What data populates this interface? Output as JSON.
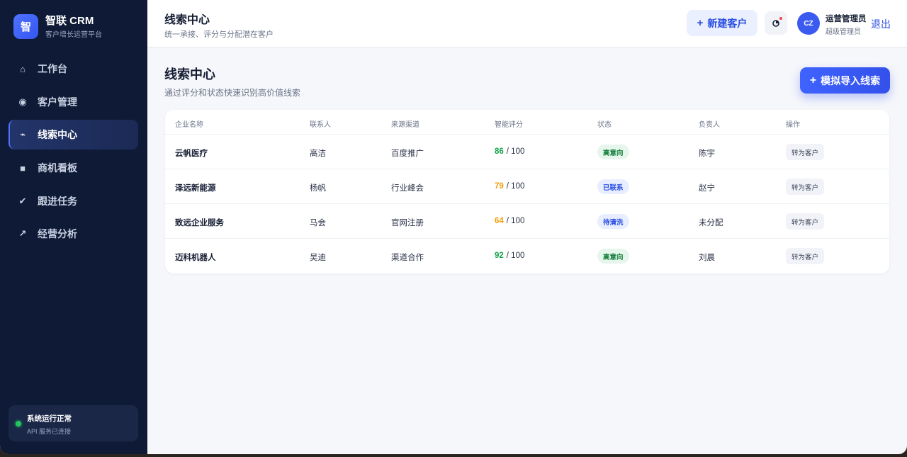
{
  "brand": {
    "logo_char": "智",
    "name": "智联 CRM",
    "subtitle": "客户增长运营平台"
  },
  "sidebar": {
    "items": [
      {
        "icon": "home-icon",
        "glyph": "⌂",
        "label": "工作台",
        "active": false
      },
      {
        "icon": "target-icon",
        "glyph": "◉",
        "label": "客户管理",
        "active": false
      },
      {
        "icon": "lightning-icon",
        "glyph": "⌁",
        "label": "线索中心",
        "active": true
      },
      {
        "icon": "board-icon",
        "glyph": "■",
        "label": "商机看板",
        "active": false
      },
      {
        "icon": "check-icon",
        "glyph": "✔",
        "label": "跟进任务",
        "active": false
      },
      {
        "icon": "trend-icon",
        "glyph": "↗",
        "label": "经营分析",
        "active": false
      }
    ],
    "status": {
      "title": "系统运行正常",
      "subtitle": "API 服务已连接",
      "color": "#22c55e"
    }
  },
  "topbar": {
    "title": "线索中心",
    "subtitle": "统一承接、评分与分配潜在客户",
    "new_button": "新建客户",
    "notification_icon": "timer-icon",
    "user": {
      "initials": "CZ",
      "name": "运营管理员",
      "role": "超级管理员"
    },
    "logout": "退出"
  },
  "page": {
    "title": "线索中心",
    "subtitle": "通过评分和状态快速识别高价值线索",
    "import_button": "模拟导入线索"
  },
  "table": {
    "columns": [
      "企业名称",
      "联系人",
      "来源渠道",
      "智能评分",
      "状态",
      "负责人",
      "操作"
    ],
    "rows": [
      {
        "company": "云帆医疗",
        "contact": "高洁",
        "channel": "百度推广",
        "score": "86",
        "score_max": "/ 100",
        "score_color": "#16a34a",
        "status": "高意向",
        "status_type": "green",
        "owner": "陈宇",
        "action": "转为客户"
      },
      {
        "company": "泽远新能源",
        "contact": "杨帆",
        "channel": "行业峰会",
        "score": "79",
        "score_max": "/ 100",
        "score_color": "#f59e0b",
        "status": "已联系",
        "status_type": "blue",
        "owner": "赵宁",
        "action": "转为客户"
      },
      {
        "company": "致远企业服务",
        "contact": "马会",
        "channel": "官网注册",
        "score": "64",
        "score_max": "/ 100",
        "score_color": "#f59e0b",
        "status": "待清洗",
        "status_type": "blue",
        "owner": "未分配",
        "action": "转为客户"
      },
      {
        "company": "迈科机器人",
        "contact": "吴迪",
        "channel": "渠道合作",
        "score": "92",
        "score_max": "/ 100",
        "score_color": "#16a34a",
        "status": "高意向",
        "status_type": "green",
        "owner": "刘晨",
        "action": "转为客户"
      }
    ]
  },
  "colors": {
    "accent": "#3b5bf0",
    "sidebar_bg": "#0f1b36",
    "badge_green_bg": "#e6f6ec",
    "badge_green_fg": "#15803d",
    "badge_blue_bg": "#e8eeff",
    "badge_blue_fg": "#2b4fe0"
  }
}
